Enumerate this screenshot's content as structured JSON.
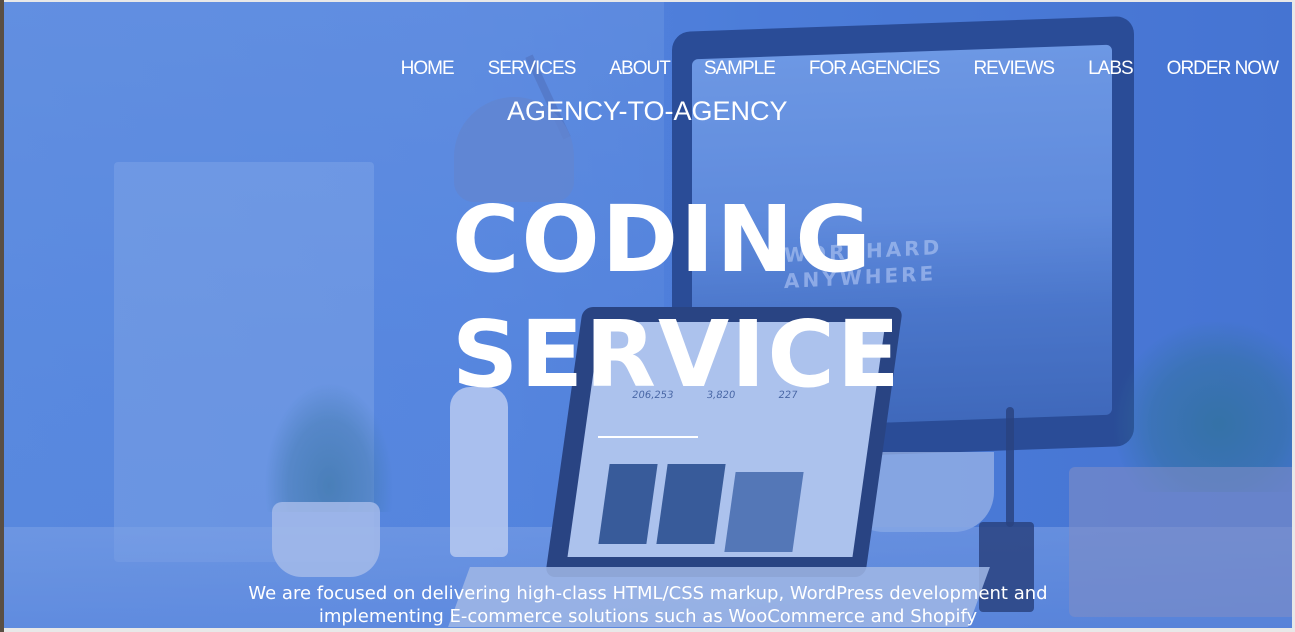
{
  "nav": {
    "items": [
      {
        "label": "HOME"
      },
      {
        "label": "SERVICES"
      },
      {
        "label": "ABOUT"
      },
      {
        "label": "SAMPLE"
      },
      {
        "label": "FOR AGENCIES"
      },
      {
        "label": "REVIEWS"
      },
      {
        "label": "LABS"
      },
      {
        "label": "ORDER NOW"
      }
    ]
  },
  "hero": {
    "eyebrow": "AGENCY-TO-AGENCY",
    "title_line1": "CODING",
    "title_line2": "SERVICE",
    "tagline_line1": "We are focused on delivering high-class HTML/CSS markup, WordPress development and",
    "tagline_line2": "implementing E-commerce solutions such as WooCommerce and Shopify"
  },
  "scene": {
    "monitor_text_line1": "WORKHARD",
    "monitor_text_line2": "ANYWHERE",
    "laptop_stats": [
      "206,253",
      "3,820",
      "227"
    ]
  },
  "colors": {
    "overlay": "#4a7bd8",
    "text": "#ffffff"
  }
}
